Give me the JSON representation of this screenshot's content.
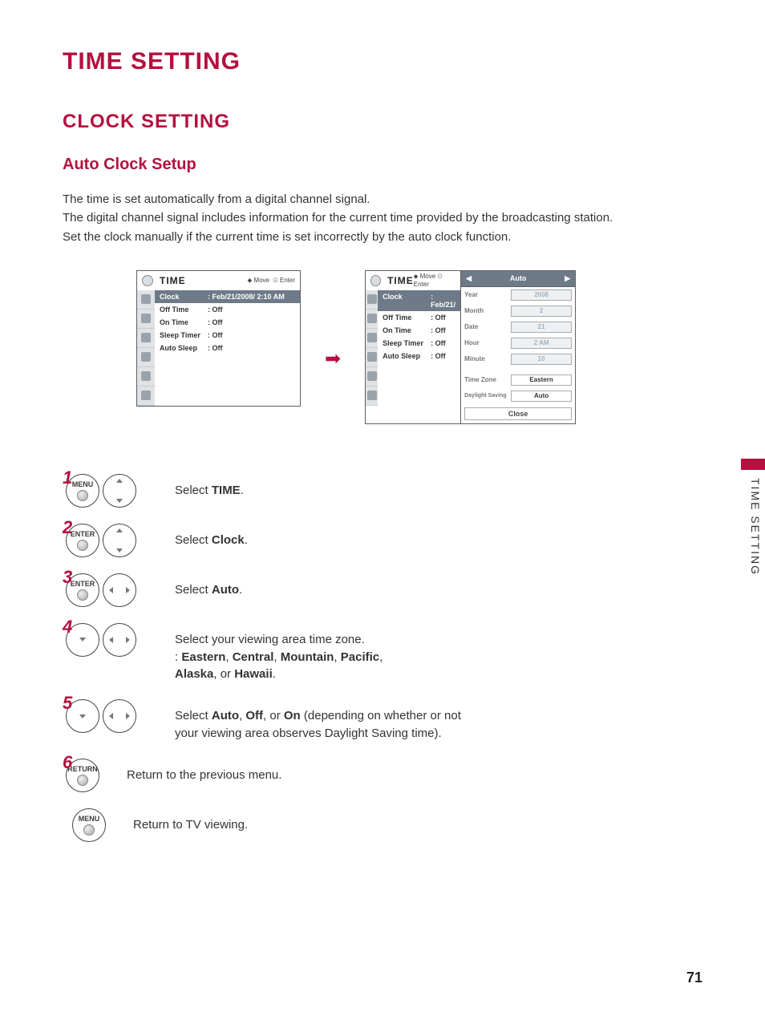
{
  "page": {
    "title": "TIME SETTING",
    "section": "CLOCK SETTING",
    "subsection": "Auto Clock Setup",
    "side_tab": "TIME SETTING",
    "number": "71"
  },
  "intro": {
    "p1": "The time is set automatically from a digital channel signal.",
    "p2": "The digital channel signal includes information for the current time provided by the broadcasting station.",
    "p3": "Set the clock manually if the current time is set incorrectly by the auto clock function."
  },
  "osd": {
    "title": "TIME",
    "nav_move": "Move",
    "nav_enter": "Enter",
    "rows": [
      {
        "k": "Clock",
        "v": ": Feb/21/2008/  2:10 AM",
        "hl": true
      },
      {
        "k": "Off Time",
        "v": ": Off"
      },
      {
        "k": "On Time",
        "v": ": Off"
      },
      {
        "k": "Sleep Timer",
        "v": ": Off"
      },
      {
        "k": "Auto Sleep",
        "v": ": Off"
      }
    ],
    "rows2": [
      {
        "k": "Clock",
        "v": ": Feb/21/",
        "hl": true
      },
      {
        "k": "Off Time",
        "v": ": Off"
      },
      {
        "k": "On Time",
        "v": ": Off"
      },
      {
        "k": "Sleep Timer",
        "v": ": Off"
      },
      {
        "k": "Auto Sleep",
        "v": ": Off"
      }
    ]
  },
  "submenu": {
    "auto_label": "Auto",
    "left_glyph": "◀",
    "right_glyph": "▶",
    "fields": [
      {
        "k": "Year",
        "v": "2008",
        "strong": false
      },
      {
        "k": "Month",
        "v": "2",
        "strong": false
      },
      {
        "k": "Date",
        "v": "21",
        "strong": false
      },
      {
        "k": "Hour",
        "v": "2 AM",
        "strong": false
      },
      {
        "k": "Minute",
        "v": "10",
        "strong": false
      },
      {
        "k": "Time Zone",
        "v": "Eastern",
        "strong": true
      },
      {
        "k": "Daylight Saving",
        "v": "Auto",
        "strong": true
      }
    ],
    "close": "Close"
  },
  "steps": {
    "s1": {
      "num": "1",
      "btn": "MENU",
      "pre": "Select ",
      "bold": "TIME",
      "post": "."
    },
    "s2": {
      "num": "2",
      "btn": "ENTER",
      "pre": "Select ",
      "bold": "Clock",
      "post": "."
    },
    "s3": {
      "num": "3",
      "btn": "ENTER",
      "pre": "Select ",
      "bold": "Auto",
      "post": "."
    },
    "s4": {
      "num": "4",
      "line1": "Select your viewing area time zone.",
      "line2_prefix": ": ",
      "z1": "Eastern",
      "c1": ", ",
      "z2": "Central",
      "c2": ", ",
      "z3": "Mountain",
      "c3": ", ",
      "z4": "Pacific",
      "c4": ",",
      "z5": "Alaska",
      "c5": ", or ",
      "z6": "Hawaii",
      "c6": "."
    },
    "s5": {
      "num": "5",
      "pre": "Select ",
      "o1": "Auto",
      "c1": ", ",
      "o2": "Off",
      "c2": ", or ",
      "o3": "On",
      "post": " (depending on whether or not your viewing area observes Daylight Saving time)."
    },
    "s6": {
      "num": "6",
      "btn": "RETURN",
      "text": "Return to the previous menu."
    },
    "s7": {
      "btn": "MENU",
      "text": "Return to TV viewing."
    }
  },
  "arrow": "➡"
}
